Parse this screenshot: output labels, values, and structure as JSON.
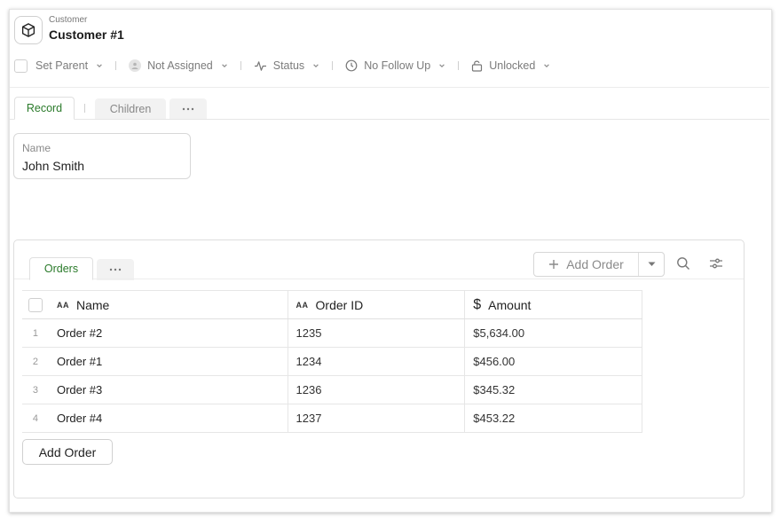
{
  "header": {
    "eyebrow": "Customer",
    "title": "Customer #1",
    "icon": "cube-icon"
  },
  "toolbar": {
    "set_parent": "Set Parent",
    "assignee": "Not Assigned",
    "status": "Status",
    "follow_up": "No Follow Up",
    "lock": "Unlocked"
  },
  "record_tabs": [
    {
      "label": "Record",
      "active": true
    },
    {
      "label": "Children",
      "active": false
    }
  ],
  "field": {
    "label": "Name",
    "value": "John Smith"
  },
  "orders_panel": {
    "tab_label": "Orders",
    "add_button_label": "Add Order",
    "footer_button_label": "Add Order",
    "columns": [
      "Name",
      "Order ID",
      "Amount"
    ],
    "rows": [
      {
        "index": "1",
        "name": "Order #2",
        "order_id": "1235",
        "amount": "$5,634.00"
      },
      {
        "index": "2",
        "name": "Order #1",
        "order_id": "1234",
        "amount": "$456.00"
      },
      {
        "index": "3",
        "name": "Order #3",
        "order_id": "1236",
        "amount": "$345.32"
      },
      {
        "index": "4",
        "name": "Order #4",
        "order_id": "1237",
        "amount": "$453.22"
      }
    ]
  },
  "colors": {
    "accent_green": "#2a7a2a",
    "muted_text": "#7b7b7b",
    "border": "#dedede"
  }
}
